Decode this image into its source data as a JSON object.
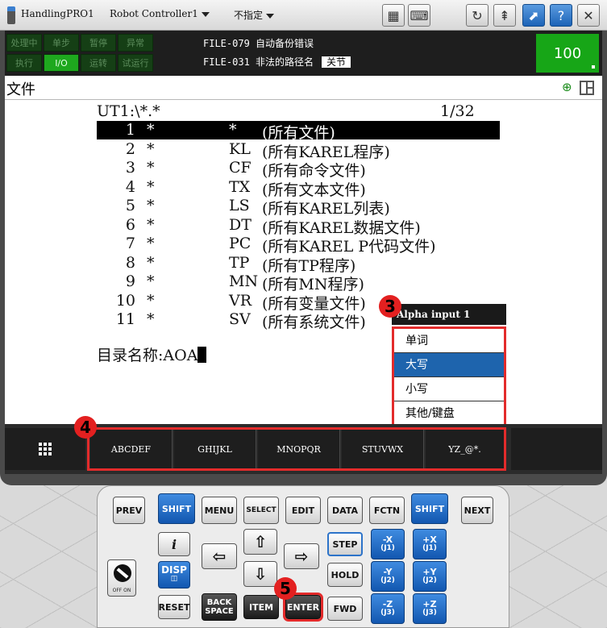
{
  "titlebar": {
    "app_name": "HandlingPRO1",
    "controller": "Robot Controller1",
    "group": "不指定",
    "icons": [
      "tp-pendant-icon",
      "dual-display-icon",
      "keyboard-icon",
      "refresh-icon",
      "jog-icon",
      "maximize-icon",
      "help-icon",
      "close-icon"
    ]
  },
  "status": {
    "leds_row1": [
      {
        "label": "处理中",
        "state": "off"
      },
      {
        "label": "单步",
        "state": "off"
      },
      {
        "label": "暂停",
        "state": "off"
      },
      {
        "label": "异常",
        "state": "off"
      }
    ],
    "leds_row2": [
      {
        "label": "执行",
        "state": "off"
      },
      {
        "label": "I/O",
        "state": "on"
      },
      {
        "label": "运转",
        "state": "off"
      },
      {
        "label": "试运行",
        "state": "off"
      }
    ],
    "alarm1": "FILE-079 自动备份错误",
    "alarm2": "FILE-031 非法的路径名",
    "alarm2_tag": "关节",
    "override": "100"
  },
  "window": {
    "title": "文件",
    "path": "UT1:\\*.*",
    "page": "1/32",
    "files": [
      {
        "num": "1",
        "name": "*",
        "ext": "*",
        "desc": "(所有文件)",
        "selected": true
      },
      {
        "num": "2",
        "name": "*",
        "ext": "KL",
        "desc": "(所有KAREL程序)"
      },
      {
        "num": "3",
        "name": "*",
        "ext": "CF",
        "desc": "(所有命令文件)"
      },
      {
        "num": "4",
        "name": "*",
        "ext": "TX",
        "desc": "(所有文本文件)"
      },
      {
        "num": "5",
        "name": "*",
        "ext": "LS",
        "desc": "(所有KAREL列表)"
      },
      {
        "num": "6",
        "name": "*",
        "ext": "DT",
        "desc": "(所有KAREL数据文件)"
      },
      {
        "num": "7",
        "name": "*",
        "ext": "PC",
        "desc": "(所有KAREL P代码文件)"
      },
      {
        "num": "8",
        "name": "*",
        "ext": "TP",
        "desc": "(所有TP程序)"
      },
      {
        "num": "9",
        "name": "*",
        "ext": "MN",
        "desc": "(所有MN程序)"
      },
      {
        "num": "10",
        "name": "*",
        "ext": "VR",
        "desc": "(所有变量文件)"
      },
      {
        "num": "11",
        "name": "*",
        "ext": "SV",
        "desc": "(所有系统文件)"
      }
    ],
    "dir_prompt": "目录名称:",
    "dir_value": "AOA"
  },
  "popup": {
    "title": "Alpha input  1",
    "items": [
      {
        "label": "单词",
        "active": false
      },
      {
        "label": "大写",
        "active": true
      },
      {
        "label": "小写",
        "active": false
      },
      {
        "label": "其他/键盘",
        "active": false
      }
    ]
  },
  "fkeys": {
    "items": [
      "ABCDEF",
      "GHIJKL",
      "MNOPQR",
      "STUVWX",
      "YZ_@*."
    ]
  },
  "badges": {
    "b3": "3",
    "b4": "4",
    "b5": "5"
  },
  "keypad": {
    "prev": "PREV",
    "shift_left": "SHIFT",
    "menu": "MENU",
    "select": "SELECT",
    "edit": "EDIT",
    "data": "DATA",
    "fctn": "FCTN",
    "shift_right": "SHIFT",
    "next": "NEXT",
    "info": "i",
    "disp": "DISP",
    "step": "STEP",
    "hold": "HOLD",
    "reset": "RESET",
    "back1": "BACK",
    "back2": "SPACE",
    "item": "ITEM",
    "enter": "ENTER",
    "fwd": "FWD",
    "jog": [
      {
        "top": "-X",
        "sub": "(J1)"
      },
      {
        "top": "+X",
        "sub": "(J1)"
      },
      {
        "top": "-Y",
        "sub": "(J2)"
      },
      {
        "top": "+Y",
        "sub": "(J2)"
      },
      {
        "top": "-Z",
        "sub": "(J3)"
      },
      {
        "top": "+Z",
        "sub": "(J3)"
      }
    ],
    "switch_off": "OFF",
    "switch_on": "ON"
  }
}
